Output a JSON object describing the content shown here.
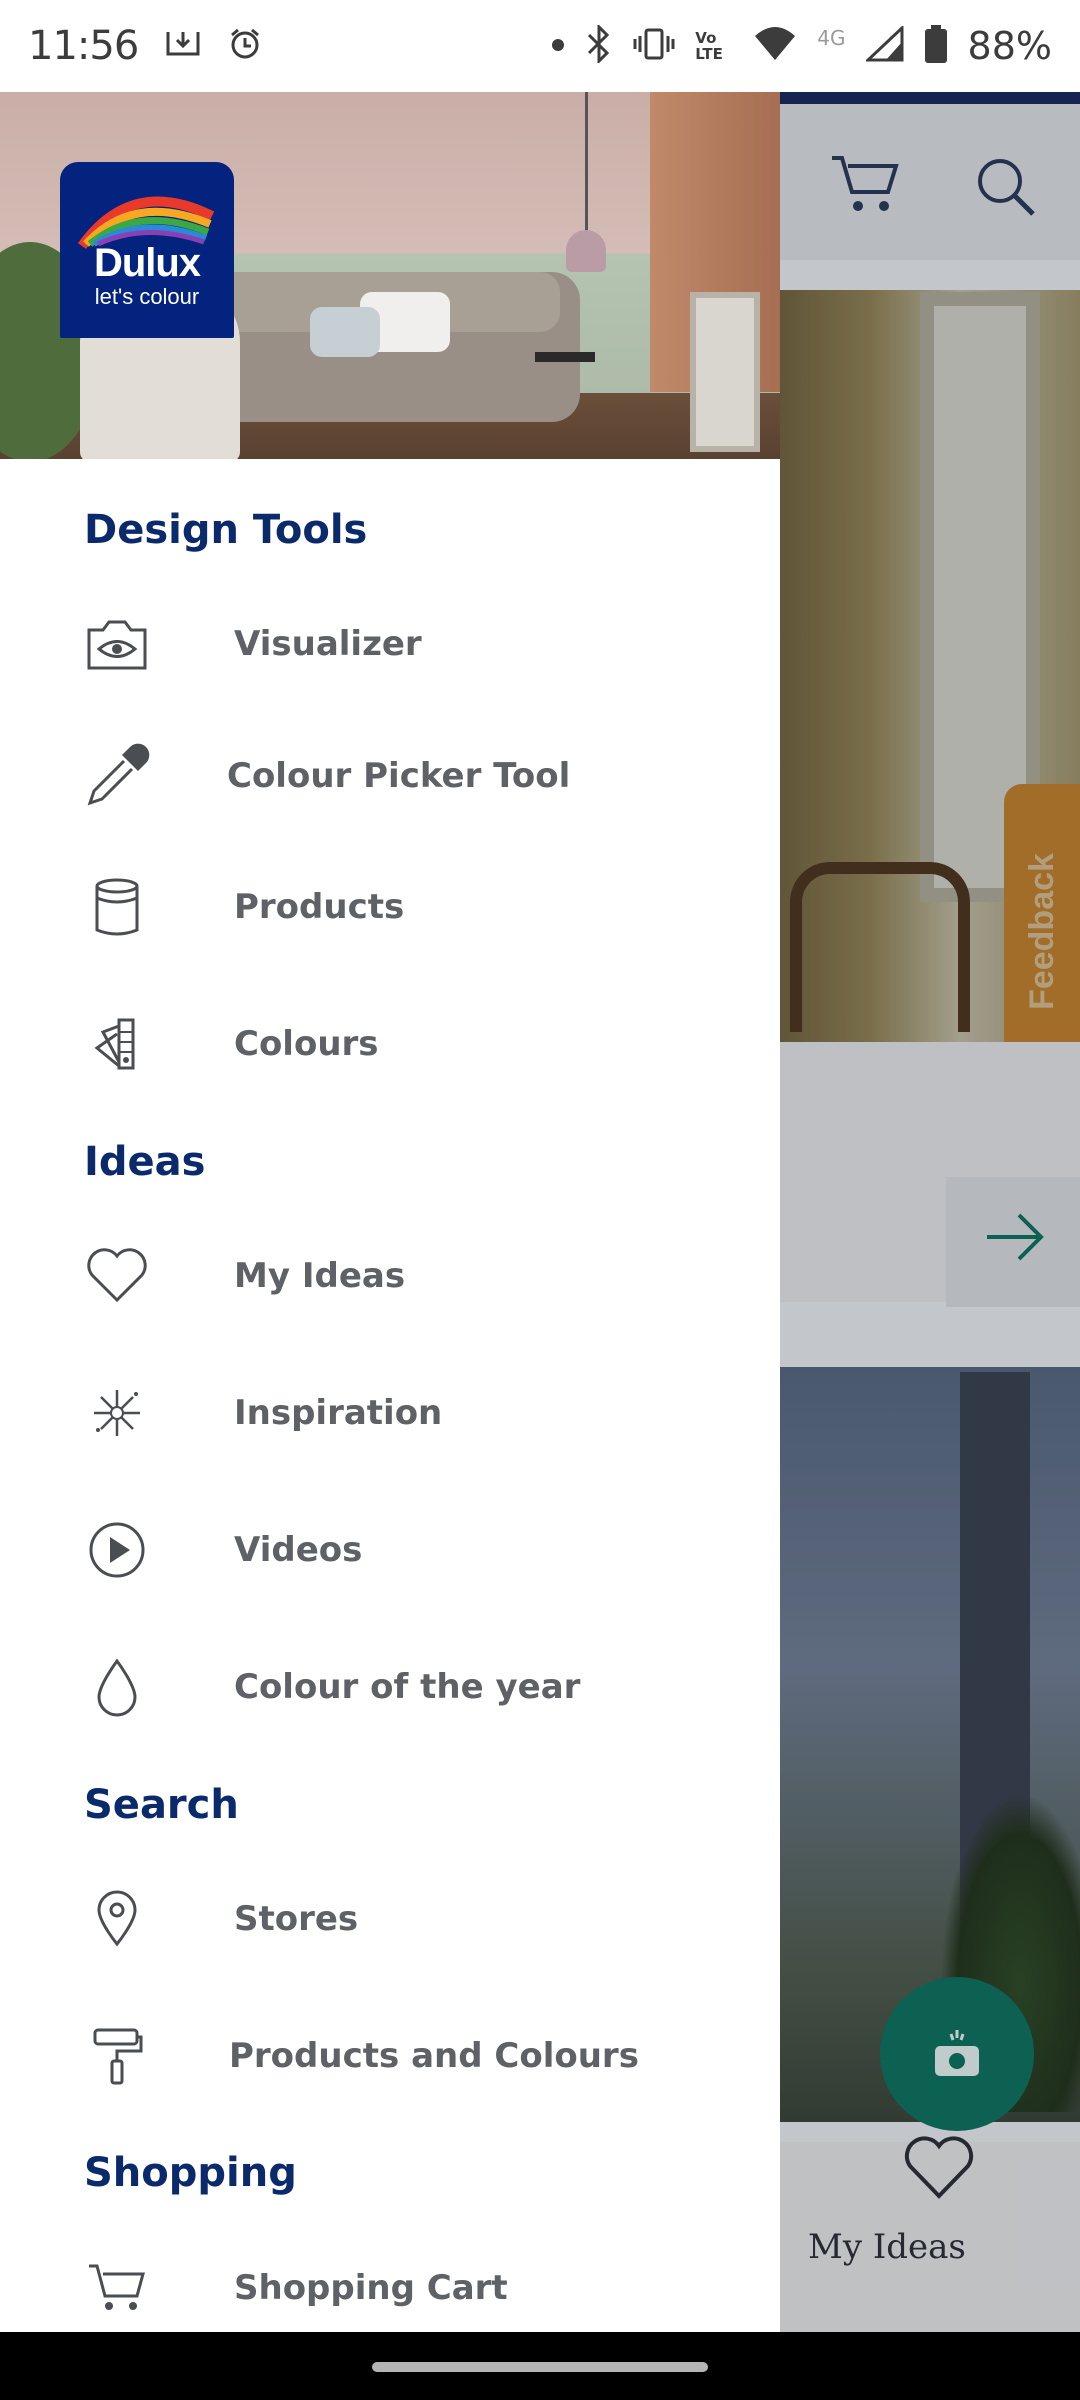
{
  "status_bar": {
    "time": "11:56",
    "battery": "88%",
    "network": "4G",
    "volte": "Vo LTE"
  },
  "drawer": {
    "logo": {
      "name": "Dulux",
      "tagline": "let's colour"
    },
    "sections": [
      {
        "title": "Design Tools",
        "items": [
          {
            "label": "Visualizer",
            "icon": "camera-eye-icon"
          },
          {
            "label": "Colour Picker Tool",
            "icon": "eyedropper-icon"
          },
          {
            "label": "Products",
            "icon": "paint-can-icon"
          },
          {
            "label": "Colours",
            "icon": "colour-swatch-icon"
          }
        ]
      },
      {
        "title": "Ideas",
        "items": [
          {
            "label": "My Ideas",
            "icon": "heart-icon"
          },
          {
            "label": "Inspiration",
            "icon": "sparkle-icon"
          },
          {
            "label": "Videos",
            "icon": "play-circle-icon"
          },
          {
            "label": "Colour of the year",
            "icon": "drop-icon"
          }
        ]
      },
      {
        "title": "Search",
        "items": [
          {
            "label": "Stores",
            "icon": "location-pin-icon"
          },
          {
            "label": "Products and Colours",
            "icon": "paint-roller-icon"
          }
        ]
      },
      {
        "title": "Shopping",
        "items": [
          {
            "label": "Shopping Cart",
            "icon": "cart-icon"
          }
        ]
      }
    ]
  },
  "background_app": {
    "feedback_label": "Feedback",
    "bottom_nav_label": "My Ideas"
  },
  "colors": {
    "brand_navy": "#03237e",
    "section_title": "#0a2a6c",
    "menu_label": "#5e6166",
    "fab": "#0f6f5e",
    "feedback_tab": "#b97d2f"
  }
}
